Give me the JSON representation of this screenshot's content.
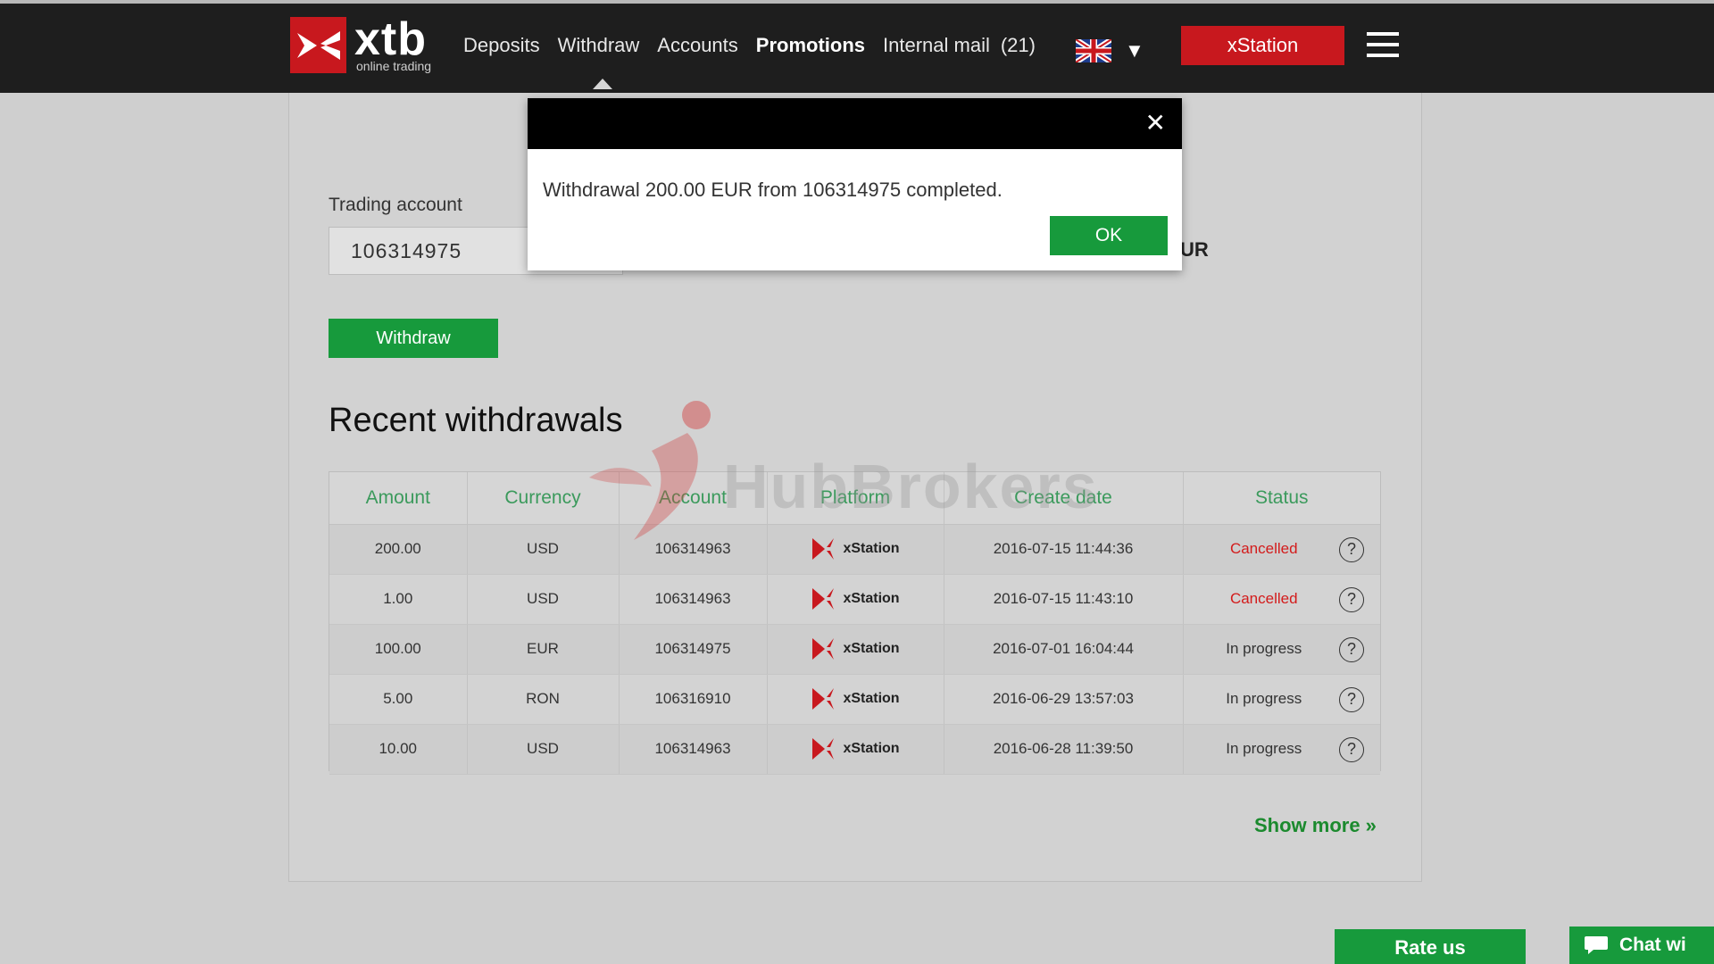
{
  "header": {
    "logo_text": "xtb",
    "logo_sub": "online trading",
    "nav": [
      "Deposits",
      "Withdraw",
      "Accounts",
      "Promotions",
      "Internal mail",
      "(21)"
    ],
    "xstation_label": "xStation"
  },
  "form": {
    "trading_label": "Trading account",
    "account_value": "106314975",
    "currency_suffix": "UR",
    "withdraw_label": "Withdraw"
  },
  "recent": {
    "title": "Recent withdrawals",
    "watermark": "HubBrokers",
    "columns": [
      "Amount",
      "Currency",
      "Account",
      "Platform",
      "Create date",
      "Status"
    ],
    "rows": [
      {
        "amount": "200.00",
        "currency": "USD",
        "account": "106314963",
        "platform": "xStation",
        "date": "2016-07-15 11:44:36",
        "status": "Cancelled"
      },
      {
        "amount": "1.00",
        "currency": "USD",
        "account": "106314963",
        "platform": "xStation",
        "date": "2016-07-15 11:43:10",
        "status": "Cancelled"
      },
      {
        "amount": "100.00",
        "currency": "EUR",
        "account": "106314975",
        "platform": "xStation",
        "date": "2016-07-01 16:04:44",
        "status": "In progress"
      },
      {
        "amount": "5.00",
        "currency": "RON",
        "account": "106316910",
        "platform": "xStation",
        "date": "2016-06-29 13:57:03",
        "status": "In progress"
      },
      {
        "amount": "10.00",
        "currency": "USD",
        "account": "106314963",
        "platform": "xStation",
        "date": "2016-06-28 11:39:50",
        "status": "In progress"
      }
    ],
    "help_symbol": "?",
    "show_more": "Show more »"
  },
  "footer": {
    "rate_label": "Rate us",
    "chat_label": "Chat wi"
  },
  "modal": {
    "close_symbol": "✕",
    "message": "Withdrawal 200.00 EUR from 106314975 completed.",
    "ok_label": "OK"
  },
  "colors": {
    "brand_red": "#c8181e",
    "action_green": "#179a3c",
    "header_bg": "#1e1e1e",
    "cancelled_red": "#d31b1b"
  }
}
